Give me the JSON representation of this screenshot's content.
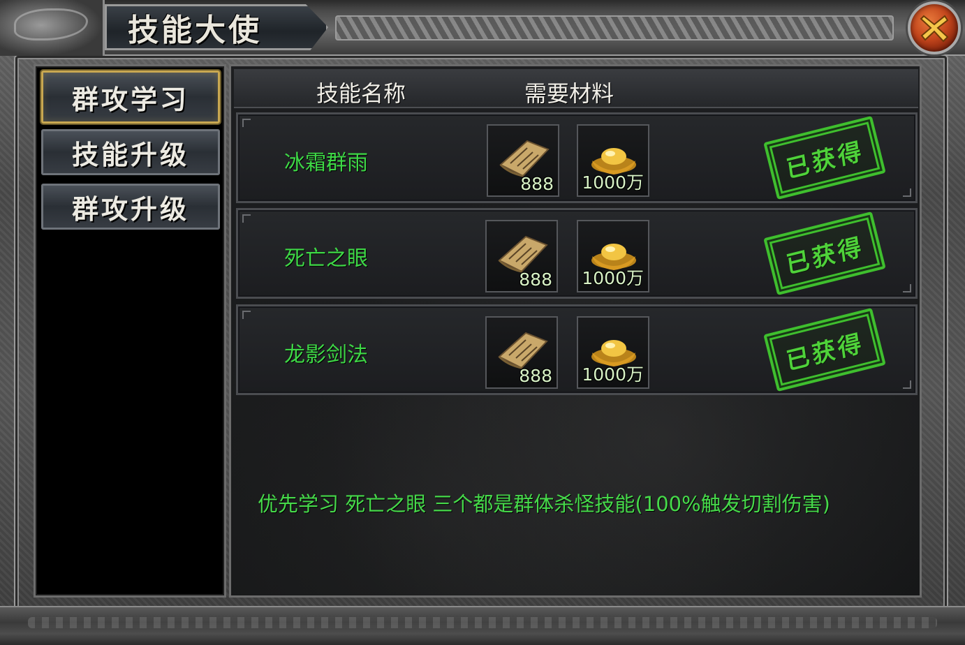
{
  "window": {
    "title": "技能大使",
    "close_icon": "close-x-icon"
  },
  "tabs": [
    {
      "label": "群攻学习",
      "active": true
    },
    {
      "label": "技能升级",
      "active": false
    },
    {
      "label": "群攻升级",
      "active": false
    }
  ],
  "table": {
    "headers": {
      "skill_name": "技能名称",
      "materials": "需要材料"
    },
    "rows": [
      {
        "skill_name": "冰霜群雨",
        "materials": [
          {
            "icon": "skill-scroll-icon",
            "count": "888"
          },
          {
            "icon": "gold-ingot-icon",
            "count": "1000万"
          }
        ],
        "status": "已获得"
      },
      {
        "skill_name": "死亡之眼",
        "materials": [
          {
            "icon": "skill-scroll-icon",
            "count": "888"
          },
          {
            "icon": "gold-ingot-icon",
            "count": "1000万"
          }
        ],
        "status": "已获得"
      },
      {
        "skill_name": "龙影剑法",
        "materials": [
          {
            "icon": "skill-scroll-icon",
            "count": "888"
          },
          {
            "icon": "gold-ingot-icon",
            "count": "1000万"
          }
        ],
        "status": "已获得"
      }
    ]
  },
  "hint": "优先学习 死亡之眼  三个都是群体杀怪技能(100%触发切割伤害)",
  "colors": {
    "skill_name": "#3ed846",
    "stamp": "#4fd23a",
    "active_tab_border": "#c9a851",
    "close_button": "#c2451c"
  }
}
